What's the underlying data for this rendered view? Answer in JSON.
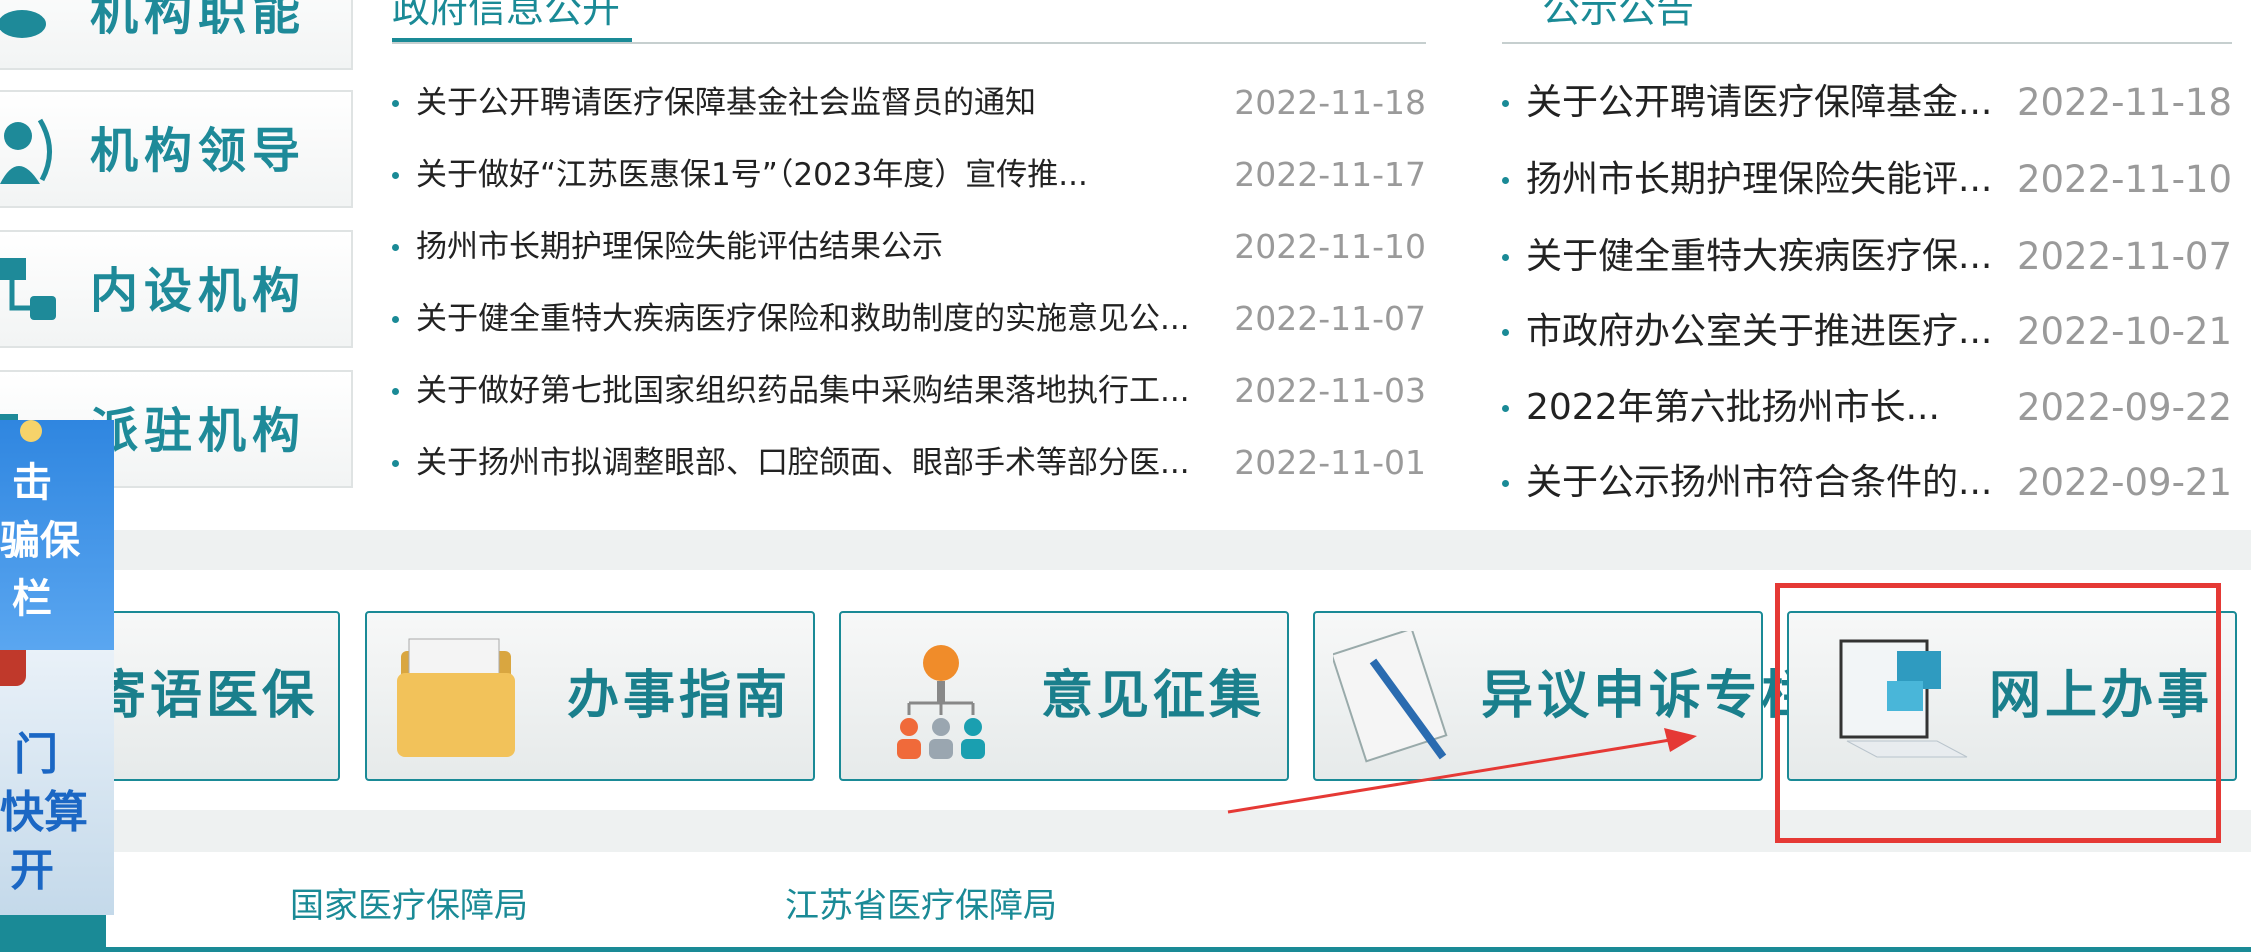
{
  "left_nav": [
    {
      "label": "机构职能"
    },
    {
      "label": "机构领导"
    },
    {
      "label": "内设机构"
    },
    {
      "label": "派驻机构"
    }
  ],
  "gov_info": {
    "title": "政府信息公开",
    "items": [
      {
        "title": "关于公开聘请医疗保障基金社会监督员的通知",
        "date": "2022-11-18"
      },
      {
        "title": "关于做好“江苏医惠保1号”（2023年度）宣传推...",
        "date": "2022-11-17"
      },
      {
        "title": "扬州市长期护理保险失能评估结果公示",
        "date": "2022-11-10"
      },
      {
        "title": "关于健全重特大疾病医疗保险和救助制度的实施意见公...",
        "date": "2022-11-07"
      },
      {
        "title": "关于做好第七批国家组织药品集中采购结果落地执行工...",
        "date": "2022-11-03"
      },
      {
        "title": "关于扬州市拟调整眼部、口腔颌面、眼部手术等部分医...",
        "date": "2022-11-01"
      }
    ]
  },
  "notices": {
    "title": "公示公告",
    "items": [
      {
        "title": "关于公开聘请医疗保障基金...",
        "date": "2022-11-18"
      },
      {
        "title": "扬州市长期护理保险失能评...",
        "date": "2022-11-10"
      },
      {
        "title": "关于健全重特大疾病医疗保...",
        "date": "2022-11-07"
      },
      {
        "title": "市政府办公室关于推进医疗...",
        "date": "2022-10-21"
      },
      {
        "title": "2022年第六批扬州市长...",
        "date": "2022-09-22"
      },
      {
        "title": "关于公示扬州市符合条件的...",
        "date": "2022-09-21"
      }
    ]
  },
  "services": [
    {
      "label": "寄语医保"
    },
    {
      "label": "办事指南"
    },
    {
      "label": "意见征集"
    },
    {
      "label": "异议申诉专栏"
    },
    {
      "label": "网上办事"
    }
  ],
  "float_ads": {
    "ad1_lines": [
      "击",
      "骗保",
      "栏"
    ],
    "ad2_lines": [
      "门",
      "快算",
      "开"
    ]
  },
  "footer_links": [
    {
      "label": "国家医疗保障局"
    },
    {
      "label": "江苏省医疗保障局"
    }
  ],
  "colors": {
    "accent": "#1a8a96",
    "highlight_box": "#e53935",
    "date_gray": "#9a9a9a"
  }
}
